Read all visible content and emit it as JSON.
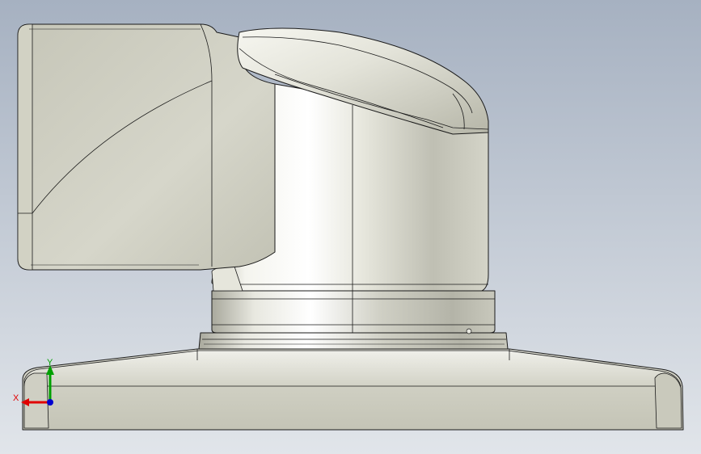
{
  "viewport": {
    "background_top": "#a9b3c2",
    "background_bottom": "#dfe3e9"
  },
  "model": {
    "body_color": "#d8d8cc",
    "edge_color": "#1a1a1a"
  },
  "triad": {
    "x_label": "X",
    "y_label": "Y",
    "x_color": "#e00000",
    "y_color": "#00a000",
    "z_color": "#0000d0"
  }
}
